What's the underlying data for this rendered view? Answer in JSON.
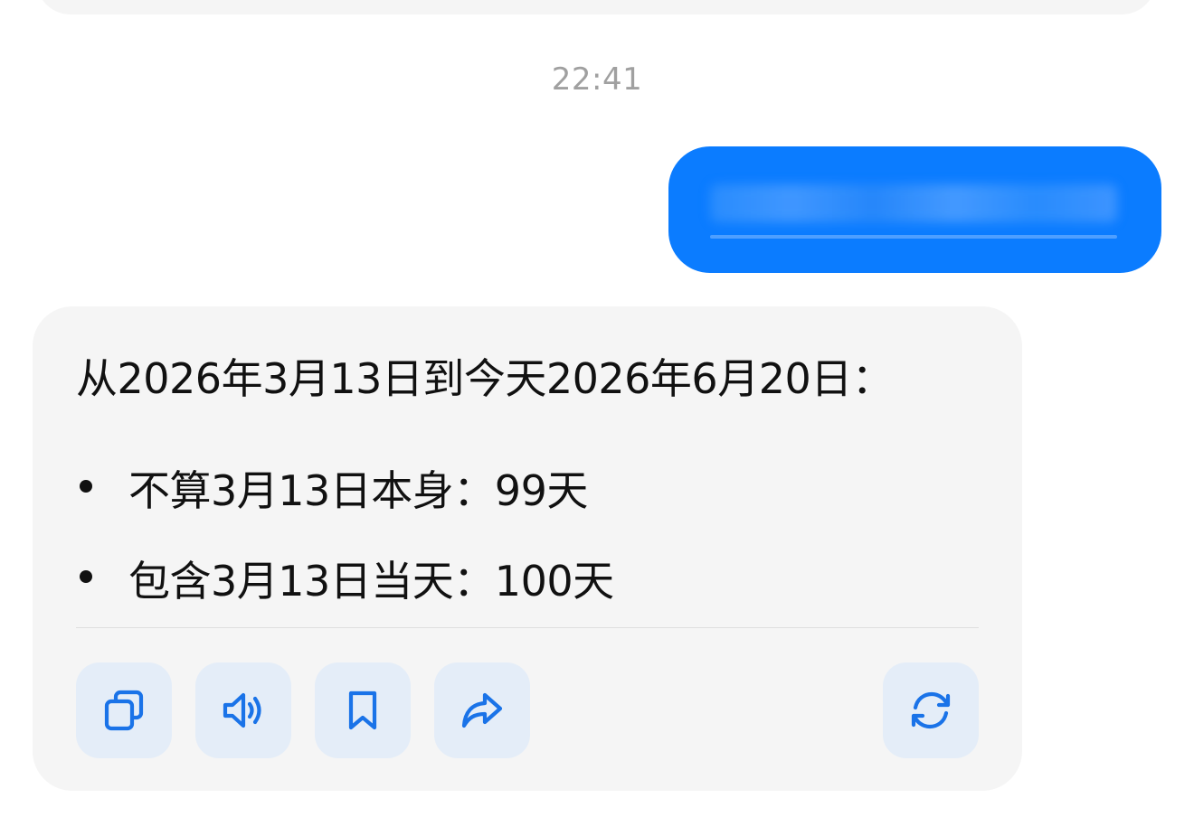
{
  "timestamp": "22:41",
  "answer": {
    "intro": "从2026年3月13日到今天2026年6月20日：",
    "bullets": [
      "不算3月13日本身：99天",
      "包含3月13日当天：100天"
    ]
  },
  "actions": {
    "copy_icon": "copy-icon",
    "speaker_icon": "speaker-icon",
    "bookmark_icon": "bookmark-icon",
    "share_icon": "share-icon",
    "regenerate_icon": "refresh-icon"
  },
  "colors": {
    "user_bubble": "#0b7cff",
    "assistant_bubble": "#f5f5f5",
    "action_button_bg": "#e4edf8",
    "action_icon": "#1a73e8",
    "timestamp_text": "#a0a0a0"
  }
}
